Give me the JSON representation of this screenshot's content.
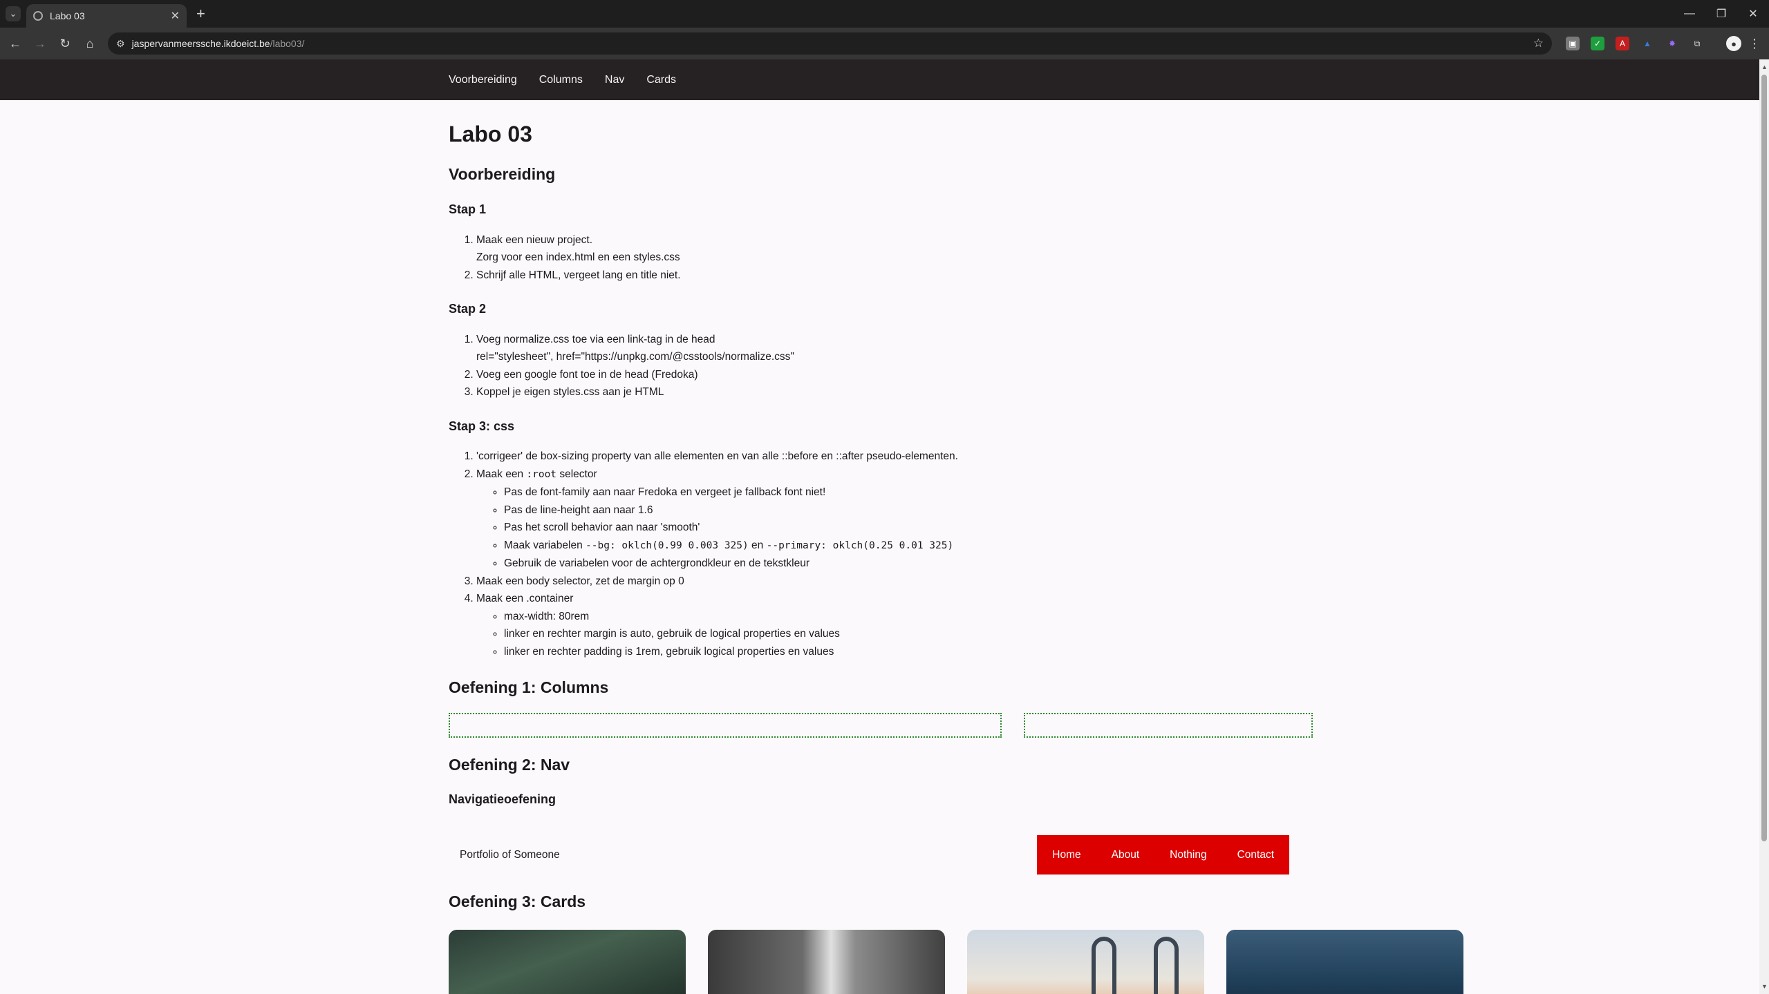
{
  "browser": {
    "tab_title": "Labo 03",
    "url_host": "jaspervanmeerssche.ikdoeict.be",
    "url_path": "/labo03/"
  },
  "site_nav": [
    "Voorbereiding",
    "Columns",
    "Nav",
    "Cards"
  ],
  "page": {
    "title": "Labo 03",
    "voorbereiding": {
      "heading": "Voorbereiding",
      "stap1": {
        "heading": "Stap 1",
        "items": [
          {
            "line1": "Maak een nieuw project.",
            "line2": "Zorg voor een index.html en een styles.css"
          },
          {
            "line1": "Schrijf alle HTML, vergeet lang en title niet."
          }
        ]
      },
      "stap2": {
        "heading": "Stap 2",
        "items": [
          {
            "line1": "Voeg normalize.css toe via een link-tag in de head",
            "line2": "rel=\"stylesheet\", href=\"https://unpkg.com/@csstools/normalize.css\""
          },
          {
            "line1": "Voeg een google font toe in de head (Fredoka)"
          },
          {
            "line1": "Koppel je eigen styles.css aan je HTML"
          }
        ]
      },
      "stap3": {
        "heading": "Stap 3: css",
        "item1": "'corrigeer' de box-sizing property van alle elementen en van alle ::before en ::after pseudo-elementen.",
        "item2_pre": "Maak een ",
        "item2_code": ":root",
        "item2_post": " selector",
        "item2_sub": [
          "Pas de font-family aan naar Fredoka en vergeet je fallback font niet!",
          "Pas de line-height aan naar 1.6",
          "Pas het scroll behavior aan naar 'smooth'"
        ],
        "item2_sub_vars_pre": "Maak variabelen ",
        "item2_sub_vars_code1": "--bg: oklch(0.99 0.003 325)",
        "item2_sub_vars_mid": " en ",
        "item2_sub_vars_code2": "--primary: oklch(0.25 0.01 325)",
        "item2_sub_last": "Gebruik de variabelen voor de achtergrondkleur en de tekstkleur",
        "item3": "Maak een body selector, zet de margin op 0",
        "item4": "Maak een .container",
        "item4_sub": [
          "max-width: 80rem",
          "linker en rechter margin is auto, gebruik de logical properties en values",
          "linker en rechter padding is 1rem, gebruik logical properties en values"
        ]
      }
    },
    "oefening1": {
      "heading": "Oefening 1: Columns"
    },
    "oefening2": {
      "heading": "Oefening 2: Nav",
      "subheading": "Navigatieoefening",
      "brand": "Portfolio of Someone",
      "menu": [
        "Home",
        "About",
        "Nothing",
        "Contact"
      ]
    },
    "oefening3": {
      "heading": "Oefening 3: Cards"
    }
  },
  "colors": {
    "header_bg": "#262224",
    "page_bg": "#fcf9fc",
    "nav_demo_red": "#dc0000",
    "columns_border": "#2a8a2a"
  }
}
